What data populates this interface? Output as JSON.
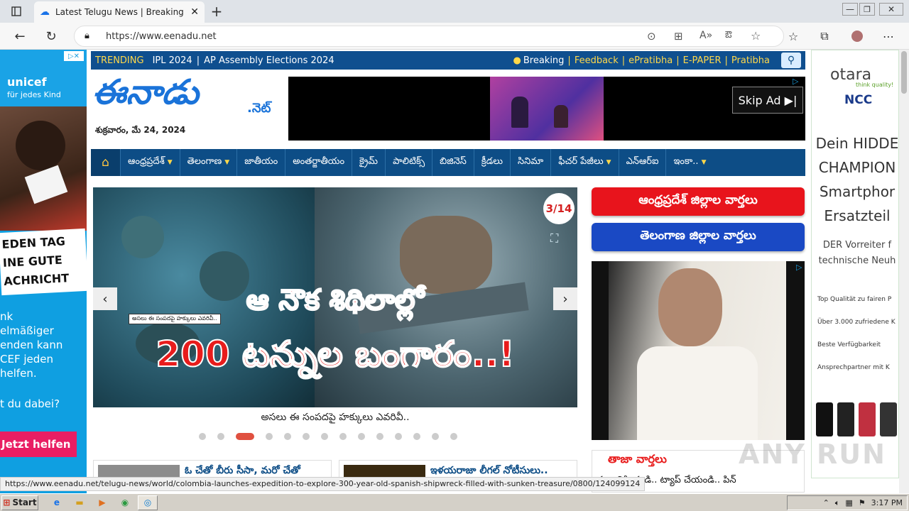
{
  "browser": {
    "tab_title": "Latest Telugu News | Breaking Ne",
    "url": "https://www.eenadu.net"
  },
  "trending": {
    "label": "TRENDING",
    "items": [
      "IPL 2024",
      "AP Assembly Elections 2024"
    ],
    "links": [
      "Breaking",
      "Feedback",
      "ePratibha",
      "E-PAPER",
      "Pratibha"
    ]
  },
  "logo": {
    "text": "ఈనాడు",
    "suffix": ".నెట్",
    "date": "శుక్రవారం, మే 24, 2024"
  },
  "top_ad": {
    "skip_label": "Skip Ad ▶|"
  },
  "nav": {
    "items": [
      "ఆంధ్రప్రదేశ్",
      "తెలంగాణ",
      "జాతీయం",
      "అంతర్జాతీయం",
      "క్రైమ్",
      "పాలిటిక్స్",
      "బిజినెస్",
      "క్రీడలు",
      "సినిమా",
      "ఫీచర్ పేజీలు",
      "ఎన్‌ఆర్‌ఐ",
      "ఇంకా.."
    ]
  },
  "slider": {
    "counter": "3/14",
    "headline_line1": "ఆ నౌక శిథిలాల్లో",
    "headline_line2": "200 టన్నుల బంగారం..!",
    "small_tag": "అసలు ఈ సంపదపై హక్కులు ఎవరివీ..",
    "caption": "అసలు ఈ సంపదపై హక్కులు ఎవరివీ..",
    "total_slides": 14,
    "active_slide": 3
  },
  "district_buttons": {
    "ap": "ఆంధ్రప్రదేశ్ జిల్లాల వార్తలు",
    "ts": "తెలంగాణ జిల్లాల వార్తలు"
  },
  "latest_news": {
    "title": "తాజా వార్తలు",
    "item1": "ఈ అతికించండి.. ట్యాప్ చేయండి.. పిన్"
  },
  "bottom_news": {
    "item1": "ఓ చేతో బీరు సీసా, మరో చేతో",
    "item2": "ఇళయరాజా లీగల్ నోటీసులు.."
  },
  "left_ad": {
    "brand": "unicef",
    "brand_sub": "für jedes Kind",
    "banner": "EDEN TAG\nINE GUTE\nACHRICHT",
    "body": "nk\nelmäßiger\nenden kann\nCEF jeden\nhelfen.",
    "question": "t du dabei?",
    "cta": "Jetzt helfen"
  },
  "right_ad": {
    "brand": "otara",
    "brand_sub": "think quality!",
    "partner": "NCC",
    "headline": "Dein HIDDE\nCHAMPION\nSmartphor\nErsatzteil",
    "sub": "DER Vorreiter f\ntechnische Neuh",
    "bullets": [
      "Top Qualität zu fairen P",
      "Über 3.000 zufriedene K",
      "Beste Verfügbarkeit",
      "Ansprechpartner mit K"
    ]
  },
  "status_url": "https://www.eenadu.net/telugu-news/world/colombia-launches-expedition-to-explore-300-year-old-spanish-shipwreck-filled-with-sunken-treasure/0800/124099124",
  "taskbar": {
    "start": "Start",
    "time": "3:17 PM"
  },
  "watermark": "ANY RUN",
  "colors": {
    "nav_blue": "#0d4d86",
    "trend_blue": "#0f4f8f",
    "ap_red": "#e8141c",
    "ts_blue": "#1a49c4",
    "unicef_blue": "#0f9fe1"
  }
}
